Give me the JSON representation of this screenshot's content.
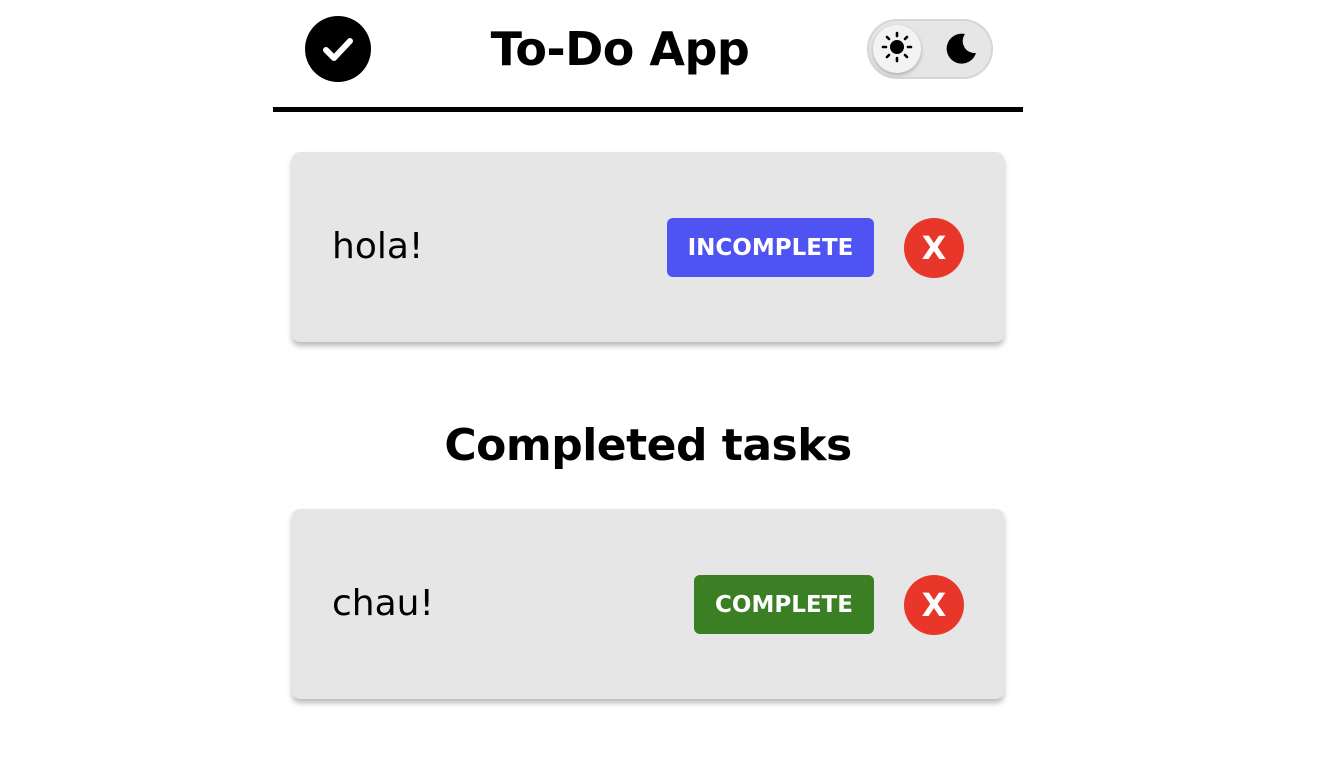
{
  "header": {
    "title": "To-Do App",
    "logo_icon": "check-circle-icon",
    "theme_toggle": {
      "light_icon": "sun-icon",
      "dark_icon": "moon-icon",
      "selected": "light"
    }
  },
  "pending_tasks": [
    {
      "text": "hola!",
      "status_label": "Incomplete",
      "delete_label": "X"
    }
  ],
  "completed_section": {
    "title": "Completed tasks"
  },
  "completed_tasks": [
    {
      "text": "chau!",
      "status_label": "Complete",
      "delete_label": "X"
    }
  ],
  "colors": {
    "incomplete_button": "#4f53f2",
    "complete_button": "#3a7f24",
    "delete_button": "#e8362b",
    "card_background": "#e6e6e6"
  }
}
